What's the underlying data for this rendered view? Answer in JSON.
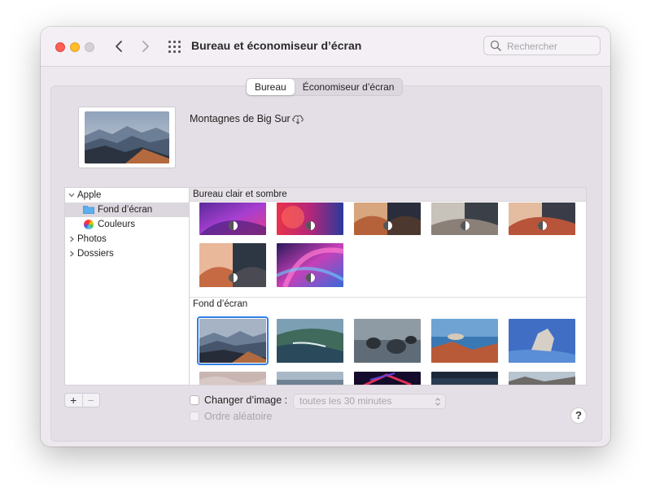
{
  "window": {
    "title": "Bureau et économiseur d’écran",
    "search_placeholder": "Rechercher"
  },
  "tabs": [
    {
      "label": "Bureau",
      "active": true
    },
    {
      "label": "Économiseur d’écran",
      "active": false
    }
  ],
  "current_wallpaper": {
    "name": "Montagnes de Big Sur",
    "download_icon": "cloud-download-icon"
  },
  "sidebar": {
    "items": [
      {
        "label": "Apple",
        "expanded": true
      },
      {
        "label": "Fond d’écran",
        "selected": true,
        "icon": "folder-icon"
      },
      {
        "label": "Couleurs",
        "icon": "color-wheel-icon"
      },
      {
        "label": "Photos",
        "expanded": false
      },
      {
        "label": "Dossiers",
        "expanded": false
      }
    ]
  },
  "sections": {
    "dynamic_title": "Bureau clair et sombre",
    "static_title": "Fond d’écran"
  },
  "footer": {
    "plus_label": "+",
    "minus_label": "−",
    "change_picture_label": "Changer d’image :",
    "change_picture_checked": false,
    "interval_value": "toutes les 30 minutes",
    "random_order_label": "Ordre aléatoire",
    "random_order_checked": false,
    "help_label": "?"
  },
  "colors": {
    "accent": "#2f7fe5",
    "close": "#ff5f57",
    "minimize": "#febc2e"
  }
}
